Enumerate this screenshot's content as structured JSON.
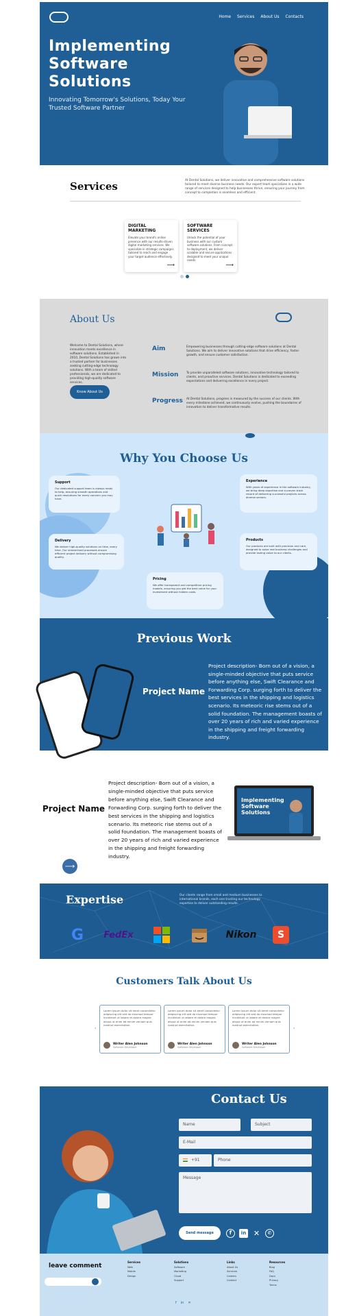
{
  "hero": {
    "nav": [
      "Home",
      "Services",
      "About Us",
      "Contacts"
    ],
    "title": "Implementing Software Solutions",
    "tagline": "Innovating Tomorrow's Solutions, Today Your Trusted Software Partner"
  },
  "services": {
    "title": "Services",
    "description": "At Dental Solutions, we deliver innovative and comprehensive software solutions tailored to meet diverse business needs. Our expert team specializes in a wide range of services designed to help businesses thrive, ensuring your journey from concept to completion is seamless and efficient.",
    "cards": [
      {
        "title": "DIGITAL MARKETING",
        "text": "Elevate your brand's online presence with our results-driven digital marketing services. We specialize in strategic campaigns tailored to reach and engage your target audience effectively."
      },
      {
        "title": "SOFTWARE SERVICES",
        "text": "Unlock the potential of your business with our custom software solutions. From concept to deployment, we deliver scalable and secure applications designed to meet your unique needs."
      }
    ]
  },
  "about": {
    "title": "About Us",
    "intro": "Welcome to Dental Solutions, where innovation meets excellence in software solutions. Established in 2010, Dental Solutions has grown into a trusted partner for businesses seeking cutting-edge technology solutions. With a team of skilled professionals, we are dedicated to providing high-quality software services.",
    "button": "Know About Us",
    "rows": [
      {
        "label": "Aim",
        "text": "Empowering businesses through cutting-edge software solutions at Dental Solutions. We aim to deliver innovative solutions that drive efficiency, foster growth, and ensure customer satisfaction."
      },
      {
        "label": "Mission",
        "text": "To provide unparalleled software solutions, innovative technology tailored to clients, and proactive services. Dental Solutions is dedicated to exceeding expectations and delivering excellence in every project."
      },
      {
        "label": "Progress",
        "text": "At Dental Solutions, progress is measured by the success of our clients. With every milestone achieved, we continuously evolve, pushing the boundaries of innovation to deliver transformative results."
      }
    ]
  },
  "why": {
    "title": "Why You Choose Us",
    "cards": [
      {
        "title": "Support",
        "text": "Our dedicated support team is always ready to help, ensuring smooth operations and quick resolutions for every concern you may have."
      },
      {
        "title": "Experience",
        "text": "With years of experience in the software industry, we bring deep expertise and a proven track record of delivering successful projects across diverse sectors."
      },
      {
        "title": "Delivery",
        "text": "We deliver high-quality solutions on time, every time. Our streamlined processes ensure efficient project delivery without compromising quality."
      },
      {
        "title": "Products",
        "text": "Our products are built with precision and care, designed to solve real business challenges and provide lasting value to our clients."
      },
      {
        "title": "Pricing",
        "text": "We offer transparent and competitive pricing models, ensuring you get the best value for your investment without hidden costs."
      }
    ]
  },
  "previous_work": {
    "title": "Previous Work",
    "project_name": "Project Name",
    "description": "Project description- Born out of a vision, a single-minded objective that puts service before anything else, Swift Clearance and Forwarding Corp. surging forth to deliver the best services in the shipping and logistics scenario. Its meteoric rise stems out of a solid foundation. The management boasts of over 20 years of rich and varied experience in the shipping and freight forwarding industry."
  },
  "project2": {
    "name": "Project Name",
    "description": "Project description- Born out of a vision, a single-minded objective that puts service before anything else, Swift Clearance and Forwarding Corp. surging forth to deliver the best services in the shipping and logistics scenario. Its meteoric rise stems out of a solid foundation. The management boasts of over 20 years of rich and varied experience in the shipping and freight forwarding industry.",
    "screen_title": "Implementing Software Solutions"
  },
  "expertise": {
    "title": "Expertise",
    "description": "Our clients range from small and medium businesses to international brands, each one trusting our technology expertise to deliver outstanding results.",
    "brands": [
      "G",
      "FedEx",
      "",
      "",
      "Nikon",
      "S"
    ]
  },
  "testimonials": {
    "title": "Customers Talk About Us",
    "cards": [
      {
        "text": "Lorem ipsum dolor sit amet consectetur adipiscing elit sed do eiusmod tempor incididunt ut labore et dolore magna aliqua ut enim ad minim veniam quis nostrud exercitation.",
        "name": "Writer Alen Johnson",
        "role": "Software Developer"
      },
      {
        "text": "Lorem ipsum dolor sit amet consectetur adipiscing elit sed do eiusmod tempor incididunt ut labore et dolore magna aliqua ut enim ad minim veniam quis nostrud exercitation.",
        "name": "Writer Alen Johnson",
        "role": "Software Developer"
      },
      {
        "text": "Lorem ipsum dolor sit amet consectetur adipiscing elit sed do eiusmod tempor incididunt ut labore et dolore magna aliqua ut enim ad minim veniam quis nostrud exercitation.",
        "name": "Writer Alen Johnson",
        "role": "Software Developer"
      }
    ]
  },
  "contact": {
    "title": "Contact Us",
    "name": "Name",
    "subject": "Subject",
    "email": "E-Mail",
    "country_code": "+91",
    "phone": "Phone",
    "message": "Message",
    "send": "Send message"
  },
  "footer": {
    "leave_comment": "leave comment",
    "columns": [
      {
        "title": "Services",
        "items": [
          "Web",
          "Mobile",
          "Design"
        ]
      },
      {
        "title": "Solutions",
        "items": [
          "Software",
          "Marketing",
          "Cloud",
          "Support"
        ]
      },
      {
        "title": "Links",
        "items": [
          "About Us",
          "Services",
          "Careers",
          "Contact"
        ]
      },
      {
        "title": "Resources",
        "items": [
          "Blog",
          "FAQ",
          "Docs",
          "Privacy",
          "Terms"
        ]
      }
    ]
  },
  "colors": {
    "primary": "#1f5f96",
    "light": "#cfe6fb",
    "grey": "#dadada"
  }
}
